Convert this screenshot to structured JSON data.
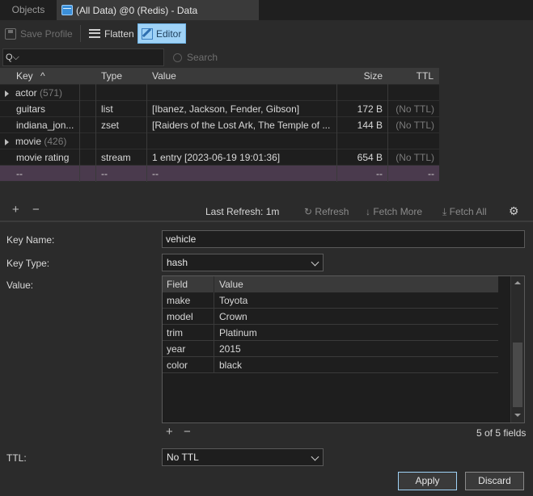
{
  "tabs": {
    "objects": "Objects",
    "data": "(All Data) @0 (Redis) - Data"
  },
  "toolbar": {
    "save_profile": "Save Profile",
    "flatten": "Flatten",
    "editor": "Editor"
  },
  "search": {
    "dropdown_value": "Q⌵",
    "placeholder": "Search"
  },
  "grid": {
    "headers": {
      "key": "Key",
      "sort_indicator": "^",
      "type": "Type",
      "value": "Value",
      "size": "Size",
      "ttl": "TTL"
    },
    "rows": [
      {
        "key": "actor",
        "count": "(571)",
        "type": "",
        "value": "",
        "size": "",
        "ttl": "",
        "group": true
      },
      {
        "key": "guitars",
        "count": "",
        "type": "list",
        "value": "[Ibanez, Jackson, Fender, Gibson]",
        "size": "172 B",
        "ttl": "(No TTL)",
        "group": false
      },
      {
        "key": "indiana_jon...",
        "count": "",
        "type": "zset",
        "value": "[Raiders of the Lost Ark, The Temple of ...",
        "size": "144 B",
        "ttl": "(No TTL)",
        "group": false
      },
      {
        "key": "movie",
        "count": "(426)",
        "type": "",
        "value": "",
        "size": "",
        "ttl": "",
        "group": true
      },
      {
        "key": "movie rating",
        "count": "",
        "type": "stream",
        "value": "1 entry [2023-06-19 19:01:36]",
        "size": "654 B",
        "ttl": "(No TTL)",
        "group": false
      },
      {
        "key": "--",
        "count": "",
        "type": "--",
        "value": "--",
        "size": "--",
        "ttl": "--",
        "group": false
      }
    ]
  },
  "statusbar": {
    "add": "+",
    "remove": "−",
    "last_refresh": "Last Refresh: 1m",
    "refresh": "Refresh",
    "fetch_more": "Fetch More",
    "fetch_all": "Fetch All"
  },
  "form": {
    "key_name_label": "Key Name:",
    "key_name_value": "vehicle",
    "key_type_label": "Key Type:",
    "key_type_value": "hash",
    "value_label": "Value:",
    "value_headers": {
      "field": "Field",
      "value": "Value"
    },
    "value_rows": [
      {
        "field": "make",
        "value": "Toyota"
      },
      {
        "field": "model",
        "value": "Crown"
      },
      {
        "field": "trim",
        "value": "Platinum"
      },
      {
        "field": "year",
        "value": "2015"
      },
      {
        "field": "color",
        "value": "black"
      }
    ],
    "add": "+",
    "remove": "−",
    "fields_count": "5 of 5 fields",
    "ttl_label": "TTL:",
    "ttl_value": "No TTL",
    "apply": "Apply",
    "discard": "Discard"
  },
  "colors": {
    "accent": "#9fd2f6",
    "selected_row": "#4a3a4d",
    "background": "#2b2b2b"
  }
}
